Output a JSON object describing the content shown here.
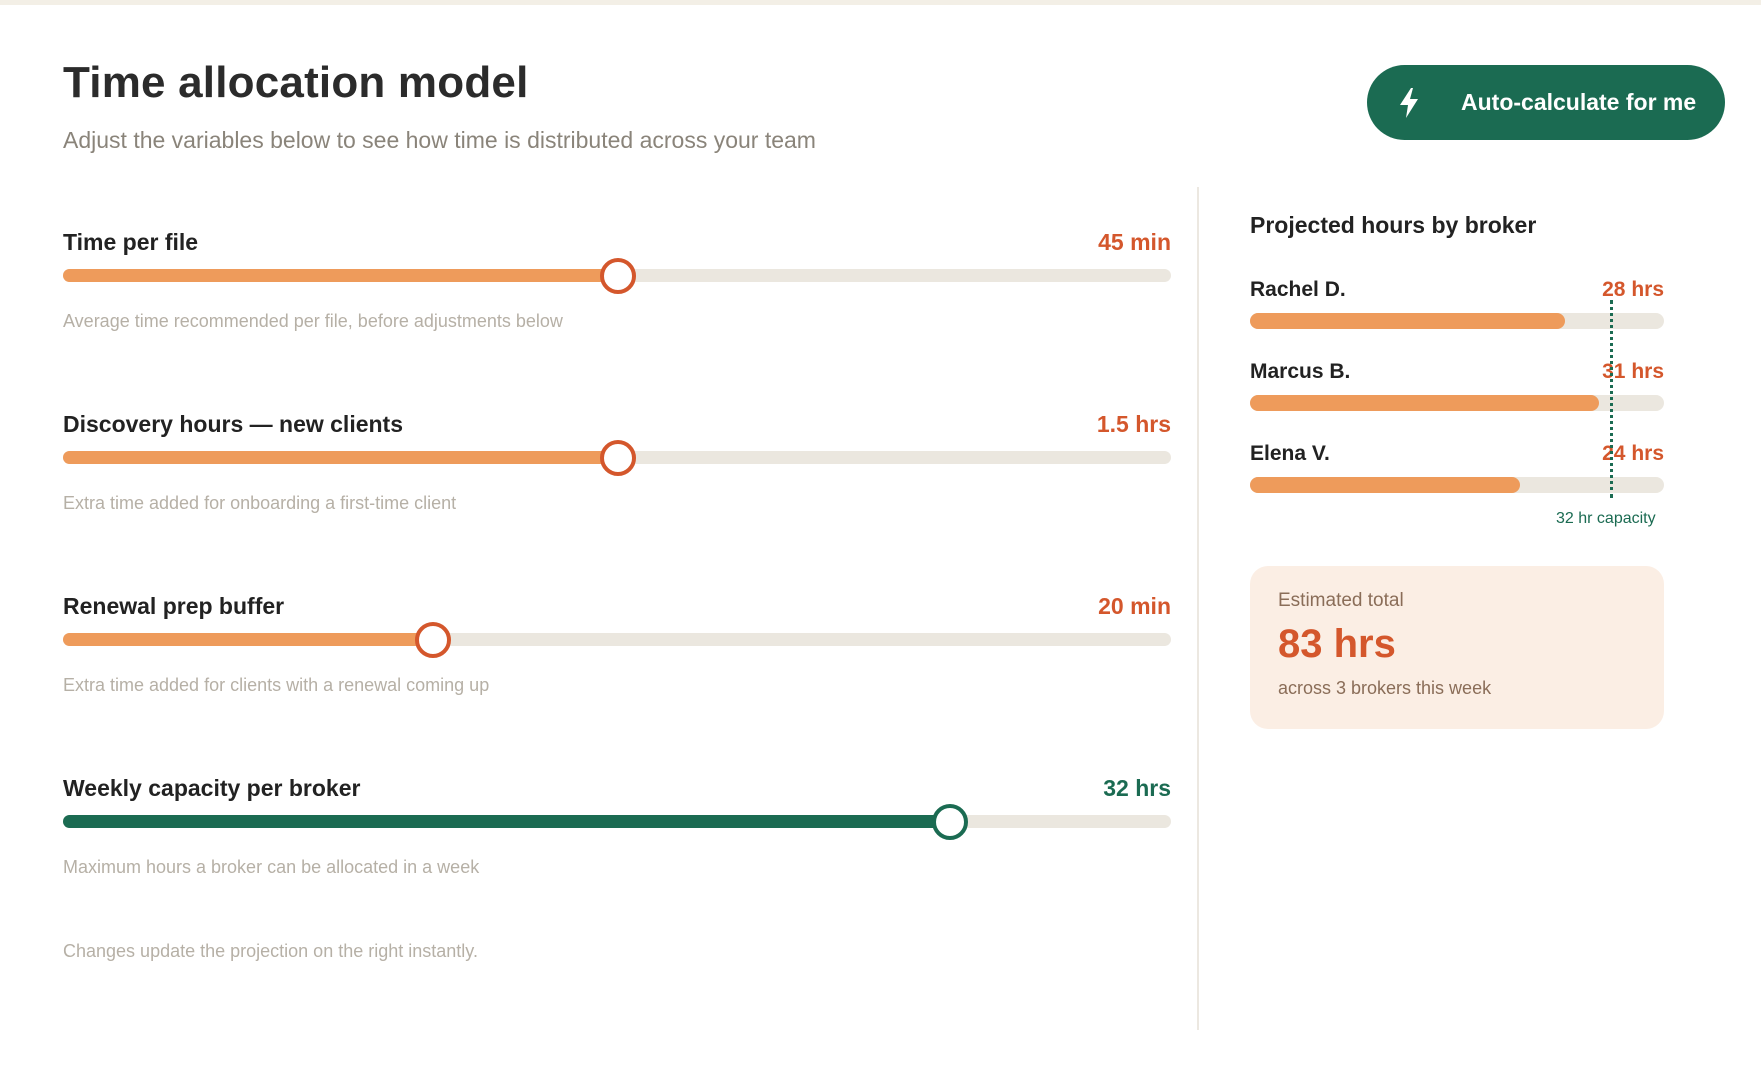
{
  "header": {
    "title": "Time allocation model",
    "subtitle": "Adjust the variables below to see how time is distributed across your team",
    "auto_button_label": "Auto-calculate for me",
    "auto_button_icon": "lightning-bolt-icon"
  },
  "colors": {
    "accent_orange": "#d4572c",
    "fill_orange": "#ee9b5b",
    "accent_green": "#1b6b52",
    "track": "#ebe7df"
  },
  "sliders": [
    {
      "label": "Time per file",
      "value_text": "45 min",
      "help": "Average time recommended per file, before adjustments below",
      "fraction": 0.5,
      "color": "orange"
    },
    {
      "label": "Discovery hours — new clients",
      "value_text": "1.5 hrs",
      "help": "Extra time added for onboarding a first-time client",
      "fraction": 0.5,
      "color": "orange"
    },
    {
      "label": "Renewal prep buffer",
      "value_text": "20 min",
      "help": "Extra time added for clients with a renewal coming up",
      "fraction": 0.333,
      "color": "orange"
    },
    {
      "label": "Weekly capacity per broker",
      "value_text": "32 hrs",
      "help": "Maximum hours a broker can be allocated in a week",
      "fraction": 0.8,
      "color": "green"
    }
  ],
  "footnote": "Changes update the projection on the right instantly.",
  "projection": {
    "title": "Projected hours by broker",
    "scale_max_hrs": 36.8,
    "capacity_hrs": 32,
    "capacity_label": "32 hr capacity",
    "brokers": [
      {
        "name": "Rachel D.",
        "hours": 28,
        "hours_text": "28 hrs"
      },
      {
        "name": "Marcus B.",
        "hours": 31,
        "hours_text": "31 hrs"
      },
      {
        "name": "Elena V.",
        "hours": 24,
        "hours_text": "24 hrs"
      }
    ]
  },
  "total": {
    "label": "Estimated total",
    "value": "83 hrs",
    "sub": "across 3 brokers this week"
  }
}
